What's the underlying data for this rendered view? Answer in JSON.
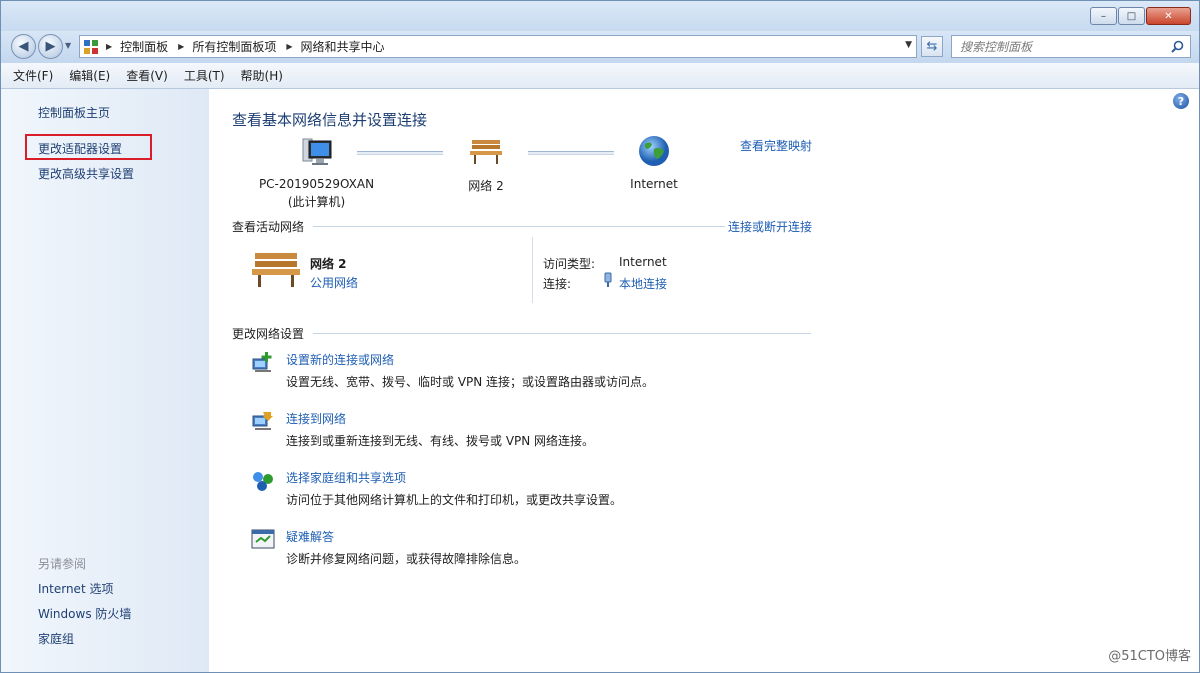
{
  "window": {
    "minimize_glyph": "–",
    "maximize_glyph": "□",
    "close_glyph": "✕"
  },
  "address": {
    "breadcrumbs": [
      "控制面板",
      "所有控制面板项",
      "网络和共享中心"
    ],
    "search_placeholder": "搜索控制面板"
  },
  "menu": [
    "文件(F)",
    "编辑(E)",
    "查看(V)",
    "工具(T)",
    "帮助(H)"
  ],
  "sidebar": {
    "links": [
      "控制面板主页",
      "更改适配器设置",
      "更改高级共享设置"
    ],
    "see_also_heading": "另请参阅",
    "see_also": [
      "Internet 选项",
      "Windows 防火墙",
      "家庭组"
    ]
  },
  "main": {
    "title": "查看基本网络信息并设置连接",
    "view_full_map": "查看完整映射",
    "map": {
      "computer_name": "PC-20190529OXAN",
      "computer_sub": "(此计算机)",
      "network_name": "网络  2",
      "internet": "Internet"
    },
    "active_networks_label": "查看活动网络",
    "connect_disconnect": "连接或断开连接",
    "active": {
      "name": "网络  2",
      "type": "公用网络",
      "access_type_label": "访问类型:",
      "access_type_value": "Internet",
      "connections_label": "连接:",
      "connections_value": "本地连接"
    },
    "change_settings_label": "更改网络设置",
    "tasks": [
      {
        "title": "设置新的连接或网络",
        "desc": "设置无线、宽带、拨号、临时或 VPN 连接；或设置路由器或访问点。"
      },
      {
        "title": "连接到网络",
        "desc": "连接到或重新连接到无线、有线、拨号或 VPN 网络连接。"
      },
      {
        "title": "选择家庭组和共享选项",
        "desc": "访问位于其他网络计算机上的文件和打印机，或更改共享设置。"
      },
      {
        "title": "疑难解答",
        "desc": "诊断并修复网络问题，或获得故障排除信息。"
      }
    ]
  },
  "watermark": "@51CTO博客",
  "colors": {
    "link": "#1e5eb3",
    "highlight_border": "#d91e2a",
    "sidebar_bg": "#e6eef8"
  },
  "icons": [
    "back-arrow-icon",
    "forward-arrow-icon",
    "control-panel-icon",
    "refresh-icon",
    "search-icon",
    "help-icon",
    "computer-icon",
    "bench-icon",
    "globe-icon",
    "plug-icon",
    "new-connection-icon",
    "connect-network-icon",
    "homegroup-icon",
    "troubleshoot-icon"
  ]
}
